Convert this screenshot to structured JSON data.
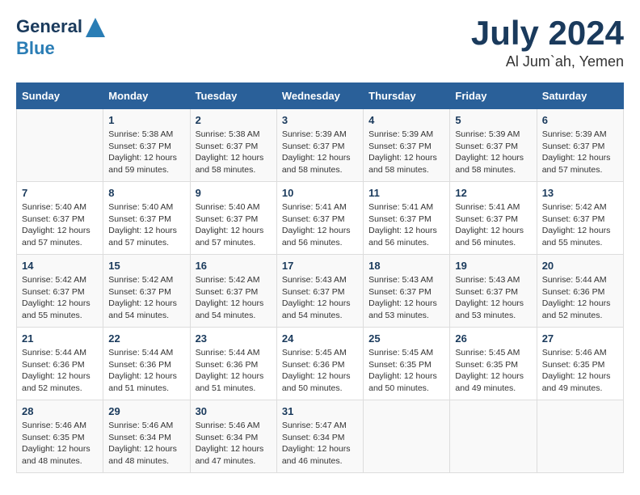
{
  "header": {
    "logo_line1": "General",
    "logo_line2": "Blue",
    "month": "July 2024",
    "location": "Al Jum`ah, Yemen"
  },
  "weekdays": [
    "Sunday",
    "Monday",
    "Tuesday",
    "Wednesday",
    "Thursday",
    "Friday",
    "Saturday"
  ],
  "weeks": [
    [
      {
        "day": "",
        "info": ""
      },
      {
        "day": "1",
        "info": "Sunrise: 5:38 AM\nSunset: 6:37 PM\nDaylight: 12 hours\nand 59 minutes."
      },
      {
        "day": "2",
        "info": "Sunrise: 5:38 AM\nSunset: 6:37 PM\nDaylight: 12 hours\nand 58 minutes."
      },
      {
        "day": "3",
        "info": "Sunrise: 5:39 AM\nSunset: 6:37 PM\nDaylight: 12 hours\nand 58 minutes."
      },
      {
        "day": "4",
        "info": "Sunrise: 5:39 AM\nSunset: 6:37 PM\nDaylight: 12 hours\nand 58 minutes."
      },
      {
        "day": "5",
        "info": "Sunrise: 5:39 AM\nSunset: 6:37 PM\nDaylight: 12 hours\nand 58 minutes."
      },
      {
        "day": "6",
        "info": "Sunrise: 5:39 AM\nSunset: 6:37 PM\nDaylight: 12 hours\nand 57 minutes."
      }
    ],
    [
      {
        "day": "7",
        "info": "Sunrise: 5:40 AM\nSunset: 6:37 PM\nDaylight: 12 hours\nand 57 minutes."
      },
      {
        "day": "8",
        "info": "Sunrise: 5:40 AM\nSunset: 6:37 PM\nDaylight: 12 hours\nand 57 minutes."
      },
      {
        "day": "9",
        "info": "Sunrise: 5:40 AM\nSunset: 6:37 PM\nDaylight: 12 hours\nand 57 minutes."
      },
      {
        "day": "10",
        "info": "Sunrise: 5:41 AM\nSunset: 6:37 PM\nDaylight: 12 hours\nand 56 minutes."
      },
      {
        "day": "11",
        "info": "Sunrise: 5:41 AM\nSunset: 6:37 PM\nDaylight: 12 hours\nand 56 minutes."
      },
      {
        "day": "12",
        "info": "Sunrise: 5:41 AM\nSunset: 6:37 PM\nDaylight: 12 hours\nand 56 minutes."
      },
      {
        "day": "13",
        "info": "Sunrise: 5:42 AM\nSunset: 6:37 PM\nDaylight: 12 hours\nand 55 minutes."
      }
    ],
    [
      {
        "day": "14",
        "info": "Sunrise: 5:42 AM\nSunset: 6:37 PM\nDaylight: 12 hours\nand 55 minutes."
      },
      {
        "day": "15",
        "info": "Sunrise: 5:42 AM\nSunset: 6:37 PM\nDaylight: 12 hours\nand 54 minutes."
      },
      {
        "day": "16",
        "info": "Sunrise: 5:42 AM\nSunset: 6:37 PM\nDaylight: 12 hours\nand 54 minutes."
      },
      {
        "day": "17",
        "info": "Sunrise: 5:43 AM\nSunset: 6:37 PM\nDaylight: 12 hours\nand 54 minutes."
      },
      {
        "day": "18",
        "info": "Sunrise: 5:43 AM\nSunset: 6:37 PM\nDaylight: 12 hours\nand 53 minutes."
      },
      {
        "day": "19",
        "info": "Sunrise: 5:43 AM\nSunset: 6:37 PM\nDaylight: 12 hours\nand 53 minutes."
      },
      {
        "day": "20",
        "info": "Sunrise: 5:44 AM\nSunset: 6:36 PM\nDaylight: 12 hours\nand 52 minutes."
      }
    ],
    [
      {
        "day": "21",
        "info": "Sunrise: 5:44 AM\nSunset: 6:36 PM\nDaylight: 12 hours\nand 52 minutes."
      },
      {
        "day": "22",
        "info": "Sunrise: 5:44 AM\nSunset: 6:36 PM\nDaylight: 12 hours\nand 51 minutes."
      },
      {
        "day": "23",
        "info": "Sunrise: 5:44 AM\nSunset: 6:36 PM\nDaylight: 12 hours\nand 51 minutes."
      },
      {
        "day": "24",
        "info": "Sunrise: 5:45 AM\nSunset: 6:36 PM\nDaylight: 12 hours\nand 50 minutes."
      },
      {
        "day": "25",
        "info": "Sunrise: 5:45 AM\nSunset: 6:35 PM\nDaylight: 12 hours\nand 50 minutes."
      },
      {
        "day": "26",
        "info": "Sunrise: 5:45 AM\nSunset: 6:35 PM\nDaylight: 12 hours\nand 49 minutes."
      },
      {
        "day": "27",
        "info": "Sunrise: 5:46 AM\nSunset: 6:35 PM\nDaylight: 12 hours\nand 49 minutes."
      }
    ],
    [
      {
        "day": "28",
        "info": "Sunrise: 5:46 AM\nSunset: 6:35 PM\nDaylight: 12 hours\nand 48 minutes."
      },
      {
        "day": "29",
        "info": "Sunrise: 5:46 AM\nSunset: 6:34 PM\nDaylight: 12 hours\nand 48 minutes."
      },
      {
        "day": "30",
        "info": "Sunrise: 5:46 AM\nSunset: 6:34 PM\nDaylight: 12 hours\nand 47 minutes."
      },
      {
        "day": "31",
        "info": "Sunrise: 5:47 AM\nSunset: 6:34 PM\nDaylight: 12 hours\nand 46 minutes."
      },
      {
        "day": "",
        "info": ""
      },
      {
        "day": "",
        "info": ""
      },
      {
        "day": "",
        "info": ""
      }
    ]
  ]
}
